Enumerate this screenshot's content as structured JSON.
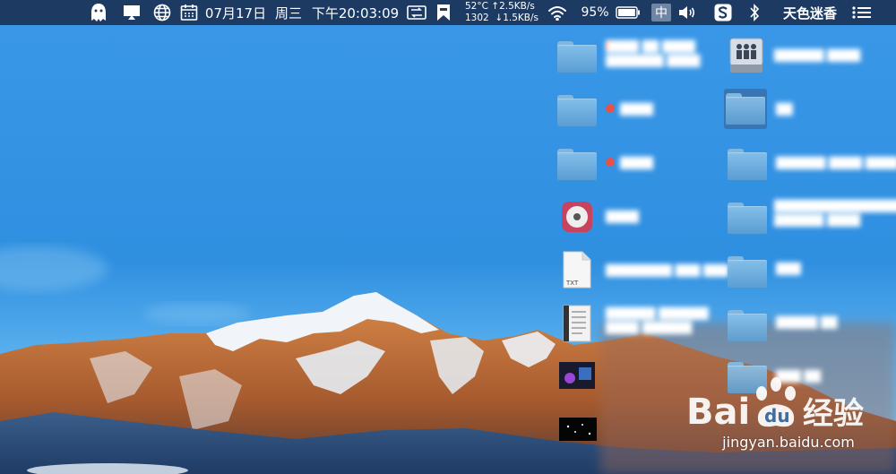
{
  "menubar": {
    "icons": [
      "ghost-icon",
      "cast-display-icon",
      "globe-icon",
      "calendar-icon",
      "switcher-icon",
      "bookmark-icon",
      "wifi-icon",
      "battery-icon",
      "volume-icon",
      "sogou-input-icon",
      "bluetooth-icon",
      "menu-list-icon"
    ],
    "date": "07月17日",
    "weekday": "周三",
    "time": "下午20:03:09",
    "cpu_temp": "52°C",
    "fan_rpm": "1302",
    "net_up": "↑2.5KB/s",
    "net_down": "↓1.5KB/s",
    "battery_percent": "95%",
    "input_method": "中",
    "user": "天色迷香"
  },
  "desktop": {
    "icons": [
      {
        "kind": "folder",
        "tag": "red"
      },
      {
        "kind": "folder",
        "tag": "red"
      },
      {
        "kind": "folder",
        "tag": "red"
      },
      {
        "kind": "app"
      },
      {
        "kind": "txt-file",
        "badge": "TXT"
      },
      {
        "kind": "document"
      },
      {
        "kind": "image"
      },
      {
        "kind": "image"
      },
      {
        "kind": "shared-drive"
      },
      {
        "kind": "folder",
        "selected": true
      },
      {
        "kind": "folder"
      },
      {
        "kind": "folder"
      },
      {
        "kind": "folder"
      },
      {
        "kind": "folder"
      },
      {
        "kind": "folder"
      }
    ]
  },
  "watermark": {
    "logo": "Bai 经验",
    "url": "jingyan.baidu.com"
  },
  "colors": {
    "menubar": "#1d3a63",
    "sky": "#3a9be6",
    "folder": "#7fb7e0",
    "tag_red": "#e2534a"
  }
}
